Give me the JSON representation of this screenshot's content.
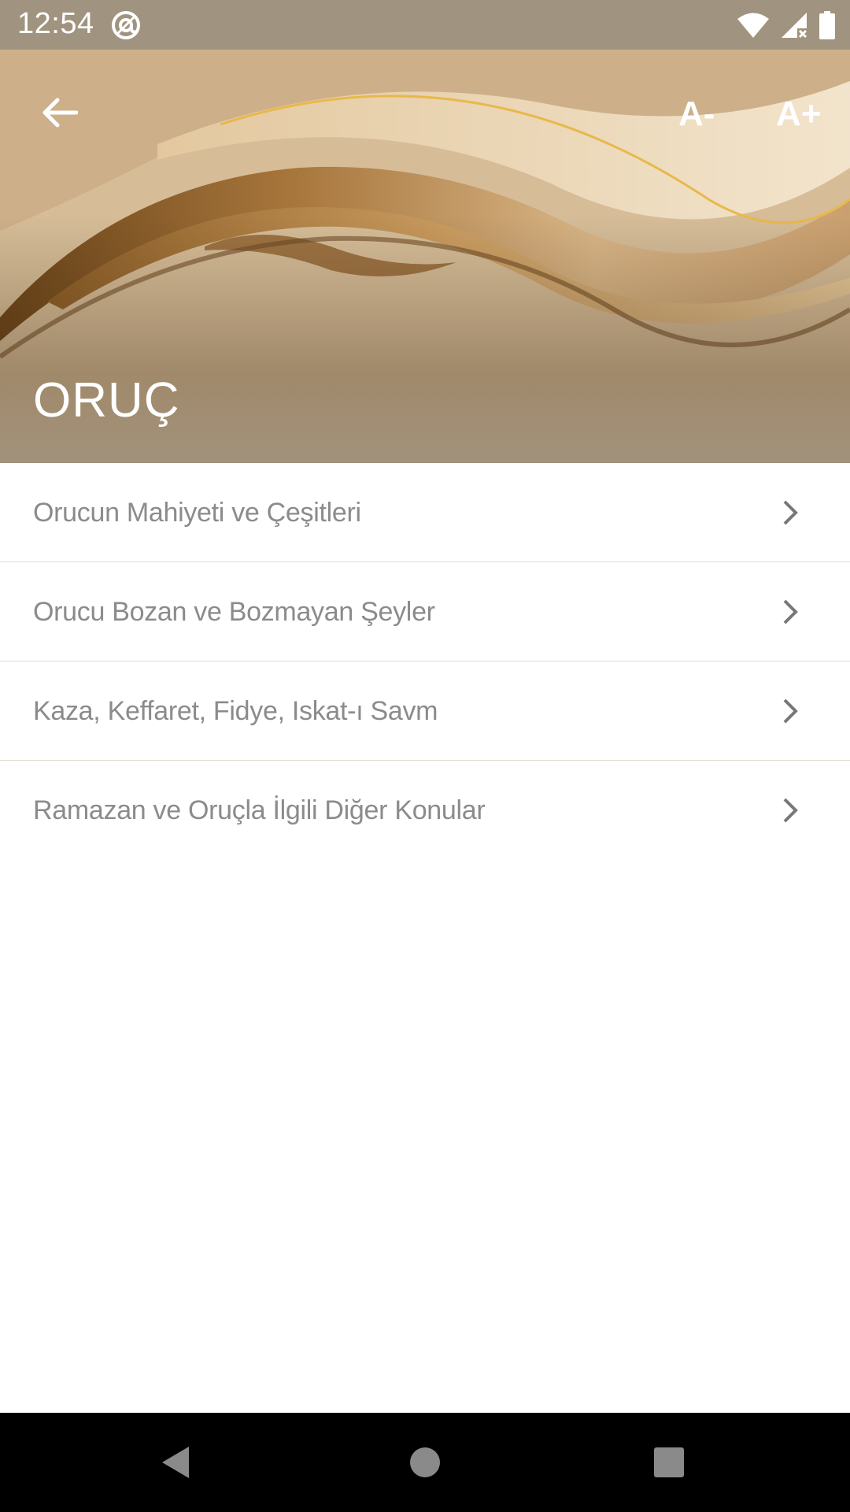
{
  "status_bar": {
    "time": "12:54",
    "icons": [
      "at-sign-icon",
      "wifi-icon",
      "cellular-no-data-icon",
      "battery-icon"
    ]
  },
  "header": {
    "title": "ORUÇ",
    "font_decrease_label": "A-",
    "font_increase_label": "A+",
    "back_icon": "arrow-left-icon"
  },
  "topics": {
    "items": [
      {
        "label": "Orucun Mahiyeti ve Çeşitleri"
      },
      {
        "label": "Orucu Bozan ve Bozmayan Şeyler"
      },
      {
        "label": "Kaza, Keffaret, Fidye, Iskat-ı Savm"
      },
      {
        "label": "Ramazan ve Oruçla İlgili Diğer Konular"
      }
    ],
    "chevron_icon": "chevron-right-icon"
  },
  "nav_bar": {
    "icons": [
      "nav-back-icon",
      "nav-home-icon",
      "nav-recents-icon"
    ]
  },
  "colors": {
    "status_bar_bg": "#a09480",
    "header_gold": "#b48c5d",
    "list_text": "#8b8b8b",
    "divider": "#e4dccf",
    "nav_bar_bg": "#000000"
  }
}
